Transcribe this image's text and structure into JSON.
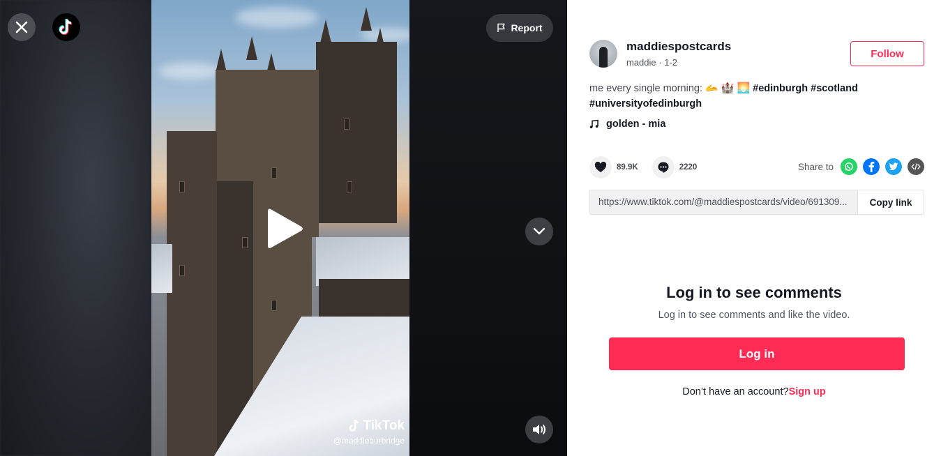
{
  "video": {
    "report_label": "Report",
    "watermark": {
      "brand": "TikTok",
      "handle": "@maddieburbridge"
    },
    "icons": {
      "close": "close-icon",
      "logo": "tiktok-logo-icon",
      "report": "flag-icon",
      "play": "play-icon",
      "next": "chevron-down-icon",
      "volume": "volume-icon"
    }
  },
  "author": {
    "username": "maddiespostcards",
    "nickname": "maddie",
    "separator": " · ",
    "date": "1-2",
    "follow_label": "Follow"
  },
  "caption": {
    "text": "me every single morning: ",
    "emojis": [
      "🫴",
      "🏰",
      "🌅"
    ],
    "hashtags": [
      "#edinburgh",
      "#scotland",
      "#universityofedinburgh"
    ]
  },
  "music": {
    "icon": "music-note-icon",
    "title": "golden - mia"
  },
  "stats": {
    "likes": "89.9K",
    "comments": "2220"
  },
  "share": {
    "label": "Share to",
    "targets": [
      "whatsapp",
      "facebook",
      "twitter",
      "embed"
    ],
    "colors": {
      "whatsapp": "#25d366",
      "facebook": "#0075fa",
      "twitter": "#1da1f2",
      "embed": "#555555"
    }
  },
  "link": {
    "url": "https://www.tiktok.com/@maddiespostcards/video/691309...",
    "copy_label": "Copy link"
  },
  "comments": {
    "title": "Log in to see comments",
    "subtitle": "Log in to see comments and like the video.",
    "login_label": "Log in",
    "no_account": "Don’t have an account?",
    "signup_label": "Sign up"
  },
  "colors": {
    "accent": "#fe2c55",
    "text": "#161823"
  }
}
